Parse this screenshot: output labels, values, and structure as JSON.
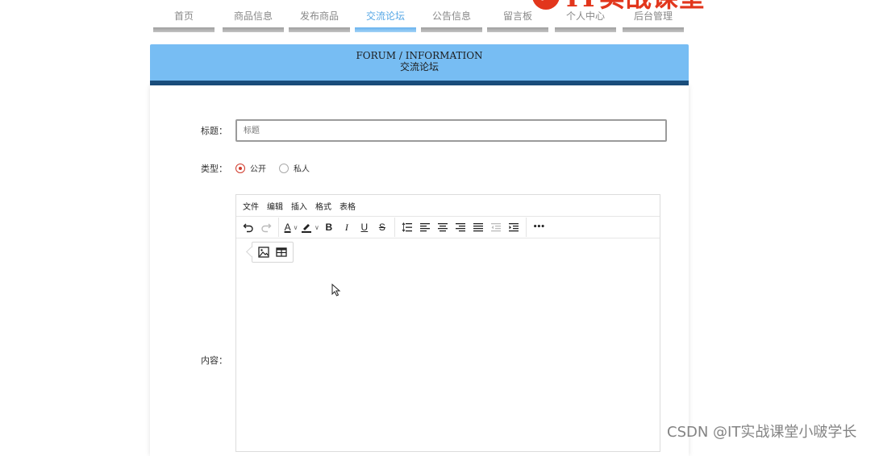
{
  "brand": {
    "text": "IT实战课堂",
    "color": "#e2361c"
  },
  "nav": {
    "items": [
      {
        "label": "首页",
        "active": false
      },
      {
        "label": "商品信息",
        "active": false
      },
      {
        "label": "发布商品",
        "active": false
      },
      {
        "label": "交流论坛",
        "active": true
      },
      {
        "label": "公告信息",
        "active": false
      },
      {
        "label": "留言板",
        "active": false
      },
      {
        "label": "个人中心",
        "active": false
      },
      {
        "label": "后台管理",
        "active": false
      }
    ],
    "active_color": "#56a7e6"
  },
  "banner": {
    "title_en": "FORUM / INFORMATION",
    "title_cn": "交流论坛",
    "color": "#77bdf3",
    "bar_color": "#1b4f7e"
  },
  "form": {
    "title_label": "标题：",
    "title_placeholder": "标题",
    "type_label": "类型：",
    "type_options": [
      {
        "label": "公开",
        "checked": true
      },
      {
        "label": "私人",
        "checked": false
      }
    ],
    "content_label": "内容："
  },
  "editor": {
    "menus": [
      "文件",
      "编辑",
      "插入",
      "格式",
      "表格"
    ],
    "toolbar": {
      "undo": "undo-icon",
      "redo": "redo-icon",
      "font_color": "A",
      "bold": "B",
      "italic": "I",
      "underline": "U",
      "strikethrough": "S",
      "more": "•••"
    },
    "quick_insert": [
      "image-icon",
      "table-icon"
    ]
  },
  "watermark": "CSDN @IT实战课堂小啵学长"
}
